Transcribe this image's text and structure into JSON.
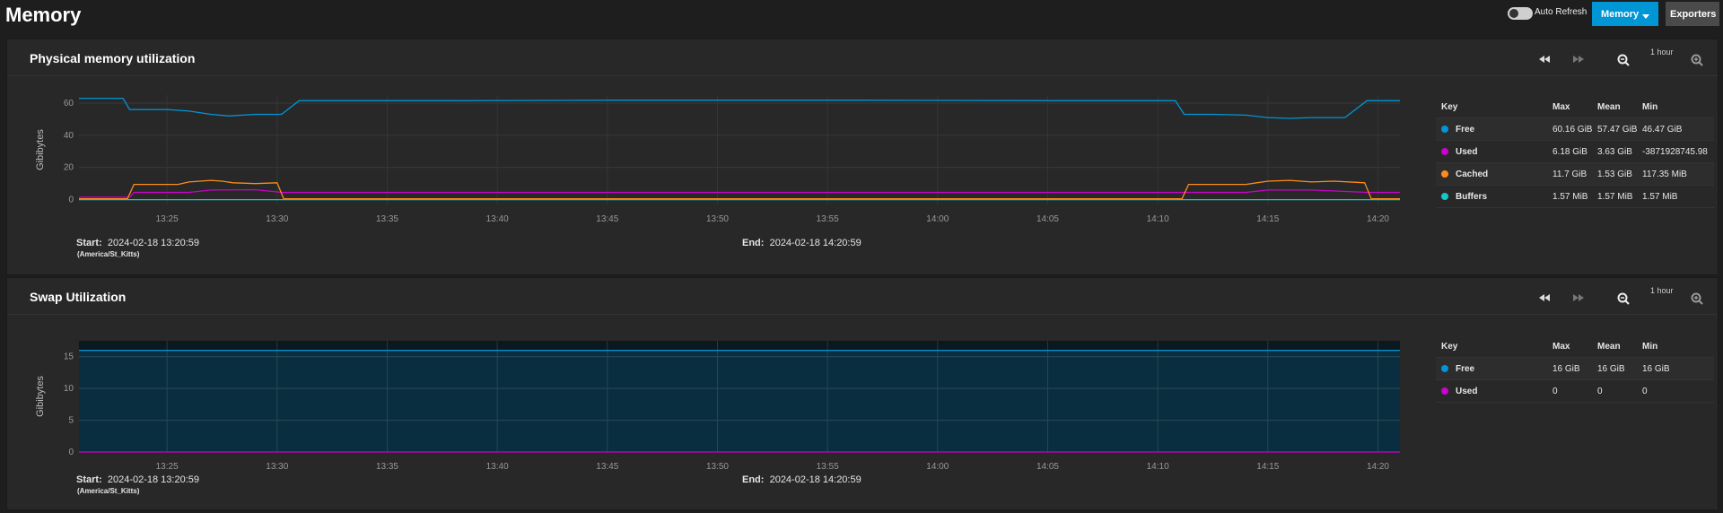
{
  "page": {
    "title": "Memory",
    "auto_refresh_label": "Auto Refresh",
    "memory_button": "Memory",
    "exporters_button": "Exporters"
  },
  "colors": {
    "free": "#0095d5",
    "used": "#cc00cc",
    "cached": "#ff8c1a",
    "buffers": "#14c8c8",
    "accent": "#0095d5"
  },
  "icons": [
    "rewind-icon",
    "fast-forward-icon",
    "zoom-out-icon",
    "zoom-in-icon",
    "chevron-down-icon"
  ],
  "x_ticks": [
    "13:25",
    "13:30",
    "13:35",
    "13:40",
    "13:45",
    "13:50",
    "13:55",
    "14:00",
    "14:05",
    "14:10",
    "14:15",
    "14:20"
  ],
  "physical": {
    "title": "Physical memory utilization",
    "range_label": "1 hour",
    "ylabel": "Gibibytes",
    "start_label": "Start:",
    "start_value": "2024-02-18 13:20:59",
    "timezone": "(America/St_Kitts)",
    "end_label": "End:",
    "end_value": "2024-02-18 14:20:59",
    "legend": {
      "headers": [
        "Key",
        "Max",
        "Mean",
        "Min"
      ],
      "rows": [
        {
          "key": "Free",
          "max": "60.16 GiB",
          "mean": "57.47 GiB",
          "min": "46.47 GiB"
        },
        {
          "key": "Used",
          "max": "6.18 GiB",
          "mean": "3.63 GiB",
          "min": "-3871928745.98"
        },
        {
          "key": "Cached",
          "max": "11.7 GiB",
          "mean": "1.53 GiB",
          "min": "117.35 MiB"
        },
        {
          "key": "Buffers",
          "max": "1.57 MiB",
          "mean": "1.57 MiB",
          "min": "1.57 MiB"
        }
      ]
    }
  },
  "swap": {
    "title": "Swap Utilization",
    "range_label": "1 hour",
    "ylabel": "Gibibytes",
    "start_label": "Start:",
    "start_value": "2024-02-18 13:20:59",
    "timezone": "(America/St_Kitts)",
    "end_label": "End:",
    "end_value": "2024-02-18 14:20:59",
    "legend": {
      "headers": [
        "Key",
        "Max",
        "Mean",
        "Min"
      ],
      "rows": [
        {
          "key": "Free",
          "max": "16 GiB",
          "mean": "16 GiB",
          "min": "16 GiB"
        },
        {
          "key": "Used",
          "max": "0",
          "mean": "0",
          "min": "0"
        }
      ]
    }
  },
  "chart_data": [
    {
      "type": "line",
      "title": "Physical memory utilization",
      "ylabel": "Gibibytes",
      "x_unit": "minutes after 13:20:59",
      "xlim": [
        0,
        60
      ],
      "ylim": [
        -3,
        65
      ],
      "yticks": [
        0,
        20,
        40,
        60
      ],
      "grid": true,
      "legend_position": "right",
      "series": [
        {
          "name": "Free",
          "color": "#0095d5",
          "x": [
            0,
            2.0,
            2.3,
            4.0,
            5.0,
            6.0,
            6.8,
            8.0,
            9.2,
            10.0,
            17,
            25,
            35,
            45,
            49.8,
            50.2,
            51.5,
            53.0,
            54.0,
            55.0,
            56.0,
            57.5,
            58.5,
            60
          ],
          "y": [
            63,
            63,
            56,
            56,
            55,
            53,
            52,
            53,
            53,
            61.5,
            61.5,
            61.8,
            61.8,
            61.5,
            61.5,
            53,
            53,
            52.5,
            51,
            50.5,
            51,
            51,
            61.5,
            61.5
          ]
        },
        {
          "name": "Used",
          "color": "#cc00cc",
          "x": [
            0,
            2.3,
            2.5,
            5.0,
            6.0,
            8.0,
            9.2,
            9.5,
            50.2,
            50.4,
            53.0,
            54.0,
            56.0,
            58.5,
            58.7,
            60
          ],
          "y": [
            1.5,
            1.5,
            4.5,
            4.5,
            6.0,
            6.2,
            4.5,
            4.5,
            4.5,
            4.5,
            4.5,
            6.0,
            6.0,
            4.5,
            4.5,
            4.5
          ]
        },
        {
          "name": "Cached",
          "color": "#ff8c1a",
          "x": [
            0,
            2.2,
            2.5,
            4.5,
            5.0,
            6.0,
            6.5,
            7.0,
            8.0,
            9.0,
            9.3,
            10,
            50.1,
            50.4,
            53.0,
            54.0,
            55.0,
            56.0,
            57.0,
            58.4,
            58.7,
            60
          ],
          "y": [
            0.5,
            0.5,
            9.5,
            9.5,
            11.0,
            12.0,
            11.5,
            10.5,
            10.0,
            10.5,
            0.5,
            0.5,
            0.5,
            9.5,
            9.5,
            11.5,
            12.0,
            11.0,
            11.5,
            10.5,
            0.5,
            0.5
          ]
        },
        {
          "name": "Buffers",
          "color": "#14c8c8",
          "x": [
            0,
            60
          ],
          "y": [
            0.0016,
            0.0016
          ]
        }
      ]
    },
    {
      "type": "area",
      "title": "Swap Utilization",
      "ylabel": "Gibibytes",
      "x_unit": "minutes after 13:20:59",
      "xlim": [
        0,
        60
      ],
      "ylim": [
        0,
        17.5
      ],
      "yticks": [
        0,
        5,
        10,
        15
      ],
      "grid": true,
      "legend_position": "right",
      "series": [
        {
          "name": "Free",
          "color": "#0095d5",
          "x": [
            0,
            60
          ],
          "y": [
            16,
            16
          ]
        },
        {
          "name": "Used",
          "color": "#cc00cc",
          "x": [
            0,
            60
          ],
          "y": [
            0,
            0
          ]
        }
      ]
    }
  ]
}
